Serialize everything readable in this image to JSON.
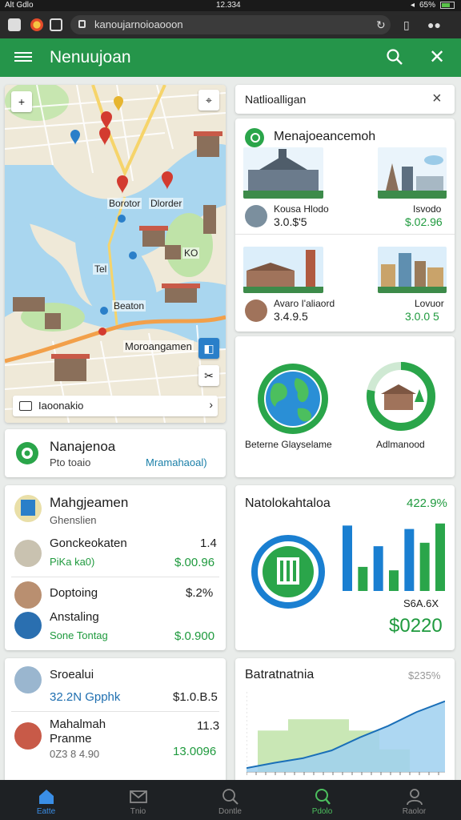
{
  "status": {
    "left": "Alt Gdlo",
    "time": "12.334",
    "battery": "65%"
  },
  "browser": {
    "url": "kanoujarnoioaooon"
  },
  "appbar": {
    "title": "Nenuujoan"
  },
  "map": {
    "labels": [
      "Borotor",
      "Dlorder",
      "KO",
      "Tel",
      "Beaton",
      "Moroangamen"
    ],
    "footer": "Iaoonakio"
  },
  "info": {
    "title": "Nanajenoa",
    "sub": "Pto toaio",
    "link": "Mramahaoal)"
  },
  "search_header": {
    "title": "Natlioalligan"
  },
  "listing": {
    "header": "Menajoeancemoh",
    "items": [
      {
        "name": "Kousa Hlodo",
        "price": "3.0.$'5",
        "alt_label": "Isvodo",
        "alt_price": "$.02.96"
      },
      {
        "name": "Avaro I'aliaord",
        "price": "3.4.9.5",
        "alt_label": "Lovuor",
        "alt_price": "3.0.0 5"
      }
    ]
  },
  "donuts": {
    "left_label": "Beterne Glayselame",
    "right_label": "Adlmanood",
    "left_pct": 0.72,
    "right_pct": 0.78
  },
  "stats": {
    "title": "Mahgjeamen",
    "subtitle": "Ghenslien",
    "rows": [
      {
        "name": "Gonckeokaten",
        "value": "1.4",
        "sub": "PiKa  ka0)",
        "sub_value": "$.00.96"
      },
      {
        "name": "Doptoing",
        "value": "$.2%"
      },
      {
        "name": "Anstaling",
        "value": "",
        "sub": "Sone Tontag",
        "sub_value": "$.0.900"
      }
    ]
  },
  "analytics": {
    "title": "Natolokahtaloa",
    "pct": "422.9%",
    "label": "S6A.6X",
    "big": "$0220",
    "bars": [
      0.95,
      0.35,
      0.65,
      0.3,
      0.9,
      0.7,
      0.98
    ],
    "bar_colors": [
      "#1a7fd1",
      "#2aa54a",
      "#1a7fd1",
      "#2aa54a",
      "#1a7fd1",
      "#2aa54a",
      "#2aa54a"
    ]
  },
  "list3": {
    "rows": [
      {
        "name": "Sroealui",
        "value": ""
      },
      {
        "name": "32.2N  Gpphk",
        "value": "$1.0.B.5"
      },
      {
        "name": "Mahalmah",
        "value": "11.3"
      },
      {
        "name": "Pranme",
        "value": ""
      },
      {
        "name": "0Z3 8 4.90",
        "value": "13.0096"
      }
    ]
  },
  "chart3": {
    "title": "Batratnatnia",
    "pct": "$235%",
    "area": [
      0.05,
      0.12,
      0.18,
      0.28,
      0.45,
      0.6,
      0.78,
      0.92
    ],
    "bars": [
      0.55,
      0.7,
      0.7,
      0.55,
      0.3
    ]
  },
  "nav": [
    {
      "label": "Eatte",
      "icon": "home-icon"
    },
    {
      "label": "Tnio",
      "icon": "mail-icon"
    },
    {
      "label": "Dontle",
      "icon": "search-icon"
    },
    {
      "label": "Pdolo",
      "icon": "explore-icon"
    },
    {
      "label": "Raolor",
      "icon": "profile-icon"
    }
  ],
  "colors": {
    "primary": "#25954a",
    "accent_blue": "#1a7fd1",
    "green": "#1f9a3e"
  }
}
